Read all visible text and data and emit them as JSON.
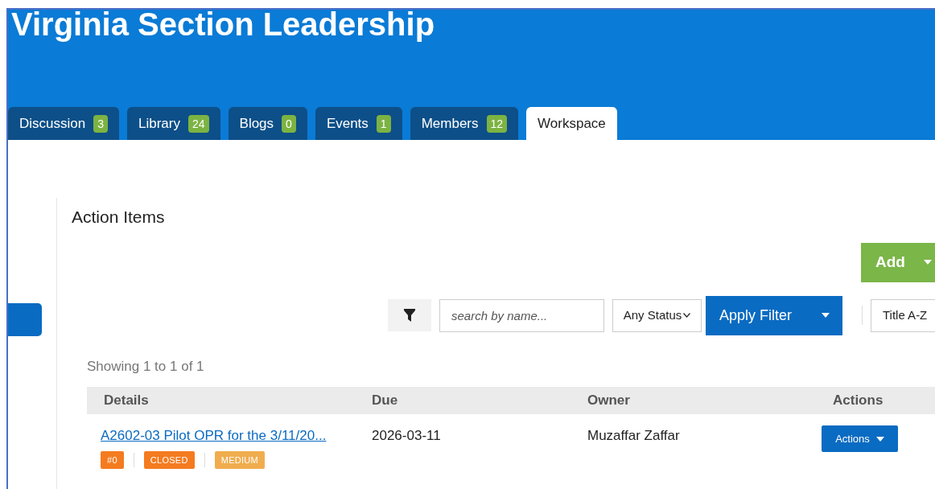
{
  "header": {
    "title": "Virginia Section Leadership"
  },
  "tabs": [
    {
      "label": "Discussion",
      "count": "3",
      "selected": false
    },
    {
      "label": "Library",
      "count": "24",
      "selected": false
    },
    {
      "label": "Blogs",
      "count": "0",
      "selected": false
    },
    {
      "label": "Events",
      "count": "1",
      "selected": false
    },
    {
      "label": "Members",
      "count": "12",
      "selected": false
    },
    {
      "label": "Workspace",
      "selected": true
    }
  ],
  "section": {
    "title": "Action Items",
    "add_button": "Add"
  },
  "filters": {
    "search": {
      "placeholder": "search by name..."
    },
    "status": "Any Status",
    "apply_button": "Apply Filter",
    "sort": "Title A-Z"
  },
  "summary": "Showing 1 to 1 of 1",
  "table": {
    "columns": [
      "Details",
      "Due",
      "Owner",
      "Actions"
    ],
    "rows": [
      {
        "details": "A2602-03 Pilot OPR for the 3/11/20...",
        "tags": [
          {
            "label": "#0",
            "color": "#f47b20"
          },
          {
            "label": "CLOSED",
            "color": "#f47b20"
          },
          {
            "label": "MEDIUM",
            "color": "#f0ad4e"
          }
        ],
        "due": "2026-03-11",
        "owner": "Muzaffar Zaffar",
        "action": "Actions"
      }
    ]
  }
}
